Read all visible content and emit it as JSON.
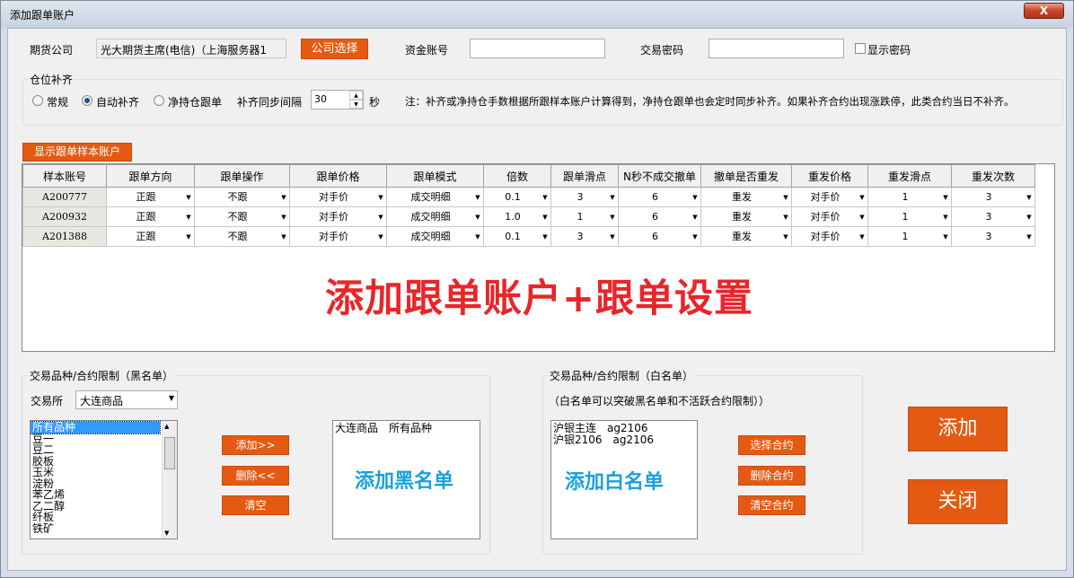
{
  "window": {
    "title": "添加跟单账户",
    "close_glyph": "X"
  },
  "top": {
    "company_label": "期货公司",
    "company_value": "光大期货主席(电信)（上海服务器1",
    "company_select_btn": "公司选择",
    "account_label": "资金账号",
    "account_value": "",
    "password_label": "交易密码",
    "password_value": "",
    "show_password_label": "显示密码"
  },
  "position": {
    "group_label": "仓位补齐",
    "radio_normal": "常规",
    "radio_auto": "自动补齐",
    "radio_net": "净持仓跟单",
    "selected": "自动补齐",
    "interval_label": "补齐同步间隔",
    "interval_value": "30",
    "interval_unit": "秒",
    "note": "注：补齐或净持仓手数根据所跟样本账户计算得到，净持仓跟单也会定时同步补齐。如果补齐合约出现涨跌停，此类合约当日不补齐。"
  },
  "show_sample_btn": "显示跟单样本账户",
  "grid": {
    "headers": [
      "样本账号",
      "跟单方向",
      "跟单操作",
      "跟单价格",
      "跟单模式",
      "倍数",
      "跟单滑点",
      "N秒不成交撤单",
      "撤单是否重发",
      "重发价格",
      "重发滑点",
      "重发次数"
    ],
    "rows": [
      [
        "A200777",
        "正跟",
        "不跟",
        "对手价",
        "成交明细",
        "0.1",
        "3",
        "6",
        "重发",
        "对手价",
        "1",
        "3"
      ],
      [
        "A200932",
        "正跟",
        "不跟",
        "对手价",
        "成交明细",
        "1.0",
        "1",
        "6",
        "重发",
        "对手价",
        "1",
        "3"
      ],
      [
        "A201388",
        "正跟",
        "不跟",
        "对手价",
        "成交明细",
        "0.1",
        "3",
        "6",
        "重发",
        "对手价",
        "1",
        "3"
      ]
    ],
    "overlay_text": "添加跟单账户+跟单设置"
  },
  "blacklist": {
    "group_label": "交易品种/合约限制（黑名单）",
    "exchange_label": "交易所",
    "exchange_value": "大连商品",
    "items": [
      "所有品种",
      "豆一",
      "豆二",
      "胶板",
      "玉米",
      "淀粉",
      "苯乙烯",
      "乙二醇",
      "纤板",
      "铁矿"
    ],
    "selected_index": 0,
    "add_btn": "添加>>",
    "delete_btn": "删除<<",
    "clear_btn": "清空",
    "result_items": [
      "大连商品　所有品种"
    ],
    "overlay_text": "添加黑名单"
  },
  "whitelist": {
    "group_label": "交易品种/合约限制（白名单）",
    "note": "（白名单可以突破黑名单和不活跃合约限制））",
    "items": [
      "沪银主连　ag2106",
      "沪银2106　ag2106"
    ],
    "select_btn": "选择合约",
    "delete_btn": "删除合约",
    "clear_btn": "清空合约",
    "overlay_text": "添加白名单"
  },
  "actions": {
    "add_btn": "添加",
    "close_btn": "关闭"
  },
  "colors": {
    "accent": "#e55a12",
    "overlay_red": "#e8262a",
    "overlay_blue": "#1aa0dd"
  }
}
